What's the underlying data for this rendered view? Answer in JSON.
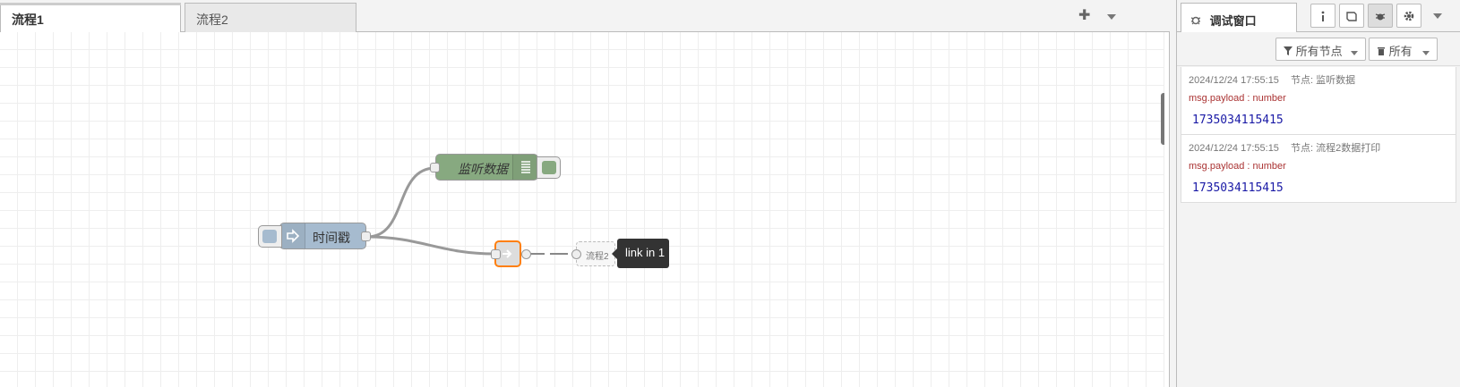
{
  "workspace": {
    "tabs": [
      {
        "label": "流程1",
        "active": true
      },
      {
        "label": "流程2",
        "active": false
      }
    ],
    "add_icon": "plus-icon",
    "menu_icon": "chevron-down-icon"
  },
  "flow": {
    "nodes": {
      "inject": {
        "label": "时间戳",
        "color": "#a6bbcf",
        "icon": "arrow-in-icon"
      },
      "debug": {
        "label": "监听数据",
        "color": "#87a980",
        "icon": "list-icon"
      },
      "link_out": {
        "color": "#dddddd",
        "icon": "link-out-icon"
      },
      "link_in": {
        "label": "流程2",
        "tooltip": "link in 1",
        "icon": "link-in-icon"
      }
    }
  },
  "sidebar": {
    "tab_label": "调试窗口",
    "tab_icon": "bug-icon",
    "buttons": [
      "info-icon",
      "book-icon",
      "bug-icon",
      "gear-icon",
      "chevron-down-icon"
    ],
    "filter_label": "所有节点",
    "clear_label": "所有",
    "messages": [
      {
        "time": "2024/12/24 17:55:15",
        "node": "节点: 监听数据",
        "topic": "msg.payload : number",
        "value": "1735034115415"
      },
      {
        "time": "2024/12/24 17:55:15",
        "node": "节点: 流程2数据打印",
        "topic": "msg.payload : number",
        "value": "1735034115415"
      }
    ]
  }
}
